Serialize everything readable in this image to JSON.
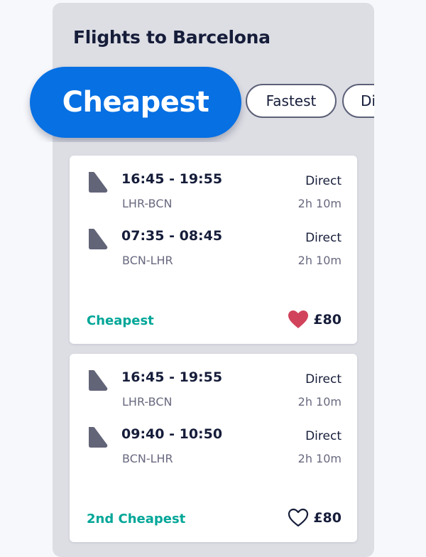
{
  "header": {
    "title": "Flights to Barcelona"
  },
  "tabs": [
    {
      "label": "Cheapest",
      "selected": true
    },
    {
      "label": "Fastest",
      "selected": false
    },
    {
      "label": "Di",
      "selected": false
    }
  ],
  "cards": [
    {
      "legs": [
        {
          "times": "16:45 - 19:55",
          "route": "LHR-BCN",
          "stops": "Direct",
          "duration": "2h 10m"
        },
        {
          "times": "07:35 - 08:45",
          "route": "BCN-LHR",
          "stops": "Direct",
          "duration": "2h 10m"
        }
      ],
      "badge": "Cheapest",
      "price": "£80",
      "saved": true
    },
    {
      "legs": [
        {
          "times": "16:45 - 19:55",
          "route": "LHR-BCN",
          "stops": "Direct",
          "duration": "2h 10m"
        },
        {
          "times": "09:40 - 10:50",
          "route": "BCN-LHR",
          "stops": "Direct",
          "duration": "2h 10m"
        }
      ],
      "badge": "2nd Cheapest",
      "price": "£80",
      "saved": false
    }
  ],
  "icons": {
    "airline": "airline-tail-icon",
    "saved": "heart-filled-icon",
    "unsaved": "heart-outline-icon"
  },
  "colors": {
    "accent": "#0770e3",
    "badge": "#00a698",
    "heart": "#d1435b",
    "text": "#161d3a"
  }
}
